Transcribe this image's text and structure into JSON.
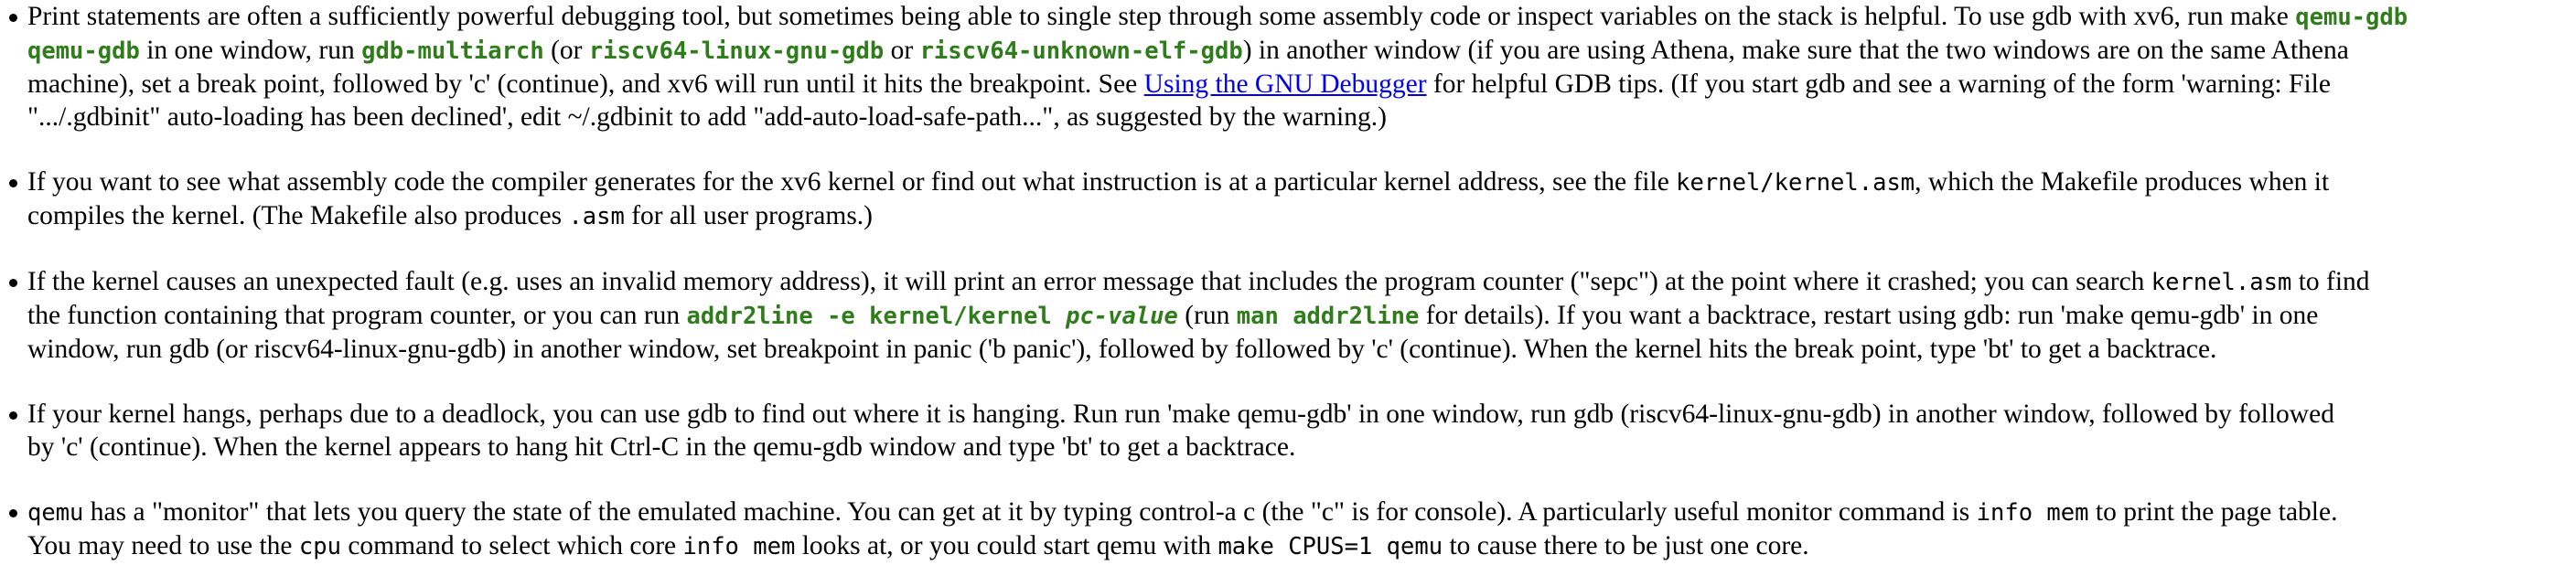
{
  "tips": {
    "gdb": {
      "t1": "Print statements are often a sufficiently powerful debugging tool, but sometimes being able to single step through some assembly code or inspect variables on the stack is helpful. To use gdb with xv6, run make ",
      "c1": "qemu-gdb",
      "t2": " in one window, run ",
      "c2": "gdb-multiarch",
      "t3": " (or ",
      "c3": "riscv64-linux-gnu-gdb",
      "t4": " or ",
      "c4": "riscv64-unknown-elf-gdb",
      "t5": ") in another window (if you are using Athena, make sure that the two windows are on the same Athena",
      "t6": "machine), set a break point, followed by 'c' (continue), and xv6 will run until it hits the breakpoint. See ",
      "link": "Using the GNU Debugger",
      "t7": " for helpful GDB tips. (If you start gdb and see a warning of the form 'warning: File",
      "t8": "\".../.gdbinit\" auto-loading has been declined', edit ~/.gdbinit to add \"add-auto-load-safe-path...\", as suggested by the warning.)"
    },
    "asm": {
      "t1": "If you want to see what assembly code the compiler generates for the xv6 kernel or find out what instruction is at a particular kernel address, see the file ",
      "c1": "kernel/kernel.asm",
      "t2": ", which the Makefile produces when it",
      "t3": "compiles the kernel. (The Makefile also produces ",
      "c2": ".asm",
      "t4": " for all user programs.)"
    },
    "fault": {
      "t1": "If the kernel causes an unexpected fault (e.g. uses an invalid memory address), it will print an error message that includes the program counter (\"sepc\") at the point where it crashed; you can search ",
      "c1": "kernel.asm",
      "t2": " to find",
      "t3": "the function containing that program counter, or you can run ",
      "c2": "addr2line -e kernel/kernel ",
      "c2i": "pc-value",
      "t4": " (run ",
      "c3": "man addr2line",
      "t5": " for details). If you want a backtrace, restart using gdb: run 'make qemu-gdb' in one",
      "t6": "window, run gdb (or riscv64-linux-gnu-gdb) in another window, set breakpoint in panic ('b panic'), followed by followed by 'c' (continue). When the kernel hits the break point, type 'bt' to get a backtrace."
    },
    "hang": {
      "t1": "If your kernel hangs, perhaps due to a deadlock, you can use gdb to find out where it is hanging. Run run 'make qemu-gdb' in one window, run gdb (riscv64-linux-gnu-gdb) in another window, followed by followed",
      "t2": "by 'c' (continue). When the kernel appears to hang hit Ctrl-C in the qemu-gdb window and type 'bt' to get a backtrace."
    },
    "qemu": {
      "c1": "qemu",
      "t1": " has a \"monitor\" that lets you query the state of the emulated machine. You can get at it by typing control-a c (the \"c\" is for console). A particularly useful monitor command is ",
      "c2": "info mem",
      "t2": " to print the page table.",
      "t3": "You may need to use the ",
      "c3": "cpu",
      "t4": " command to select which core ",
      "c4": "info mem",
      "t5": " looks at, or you could start qemu with ",
      "c5": "make CPUS=1 qemu",
      "t6": " to cause there to be just one core."
    }
  }
}
